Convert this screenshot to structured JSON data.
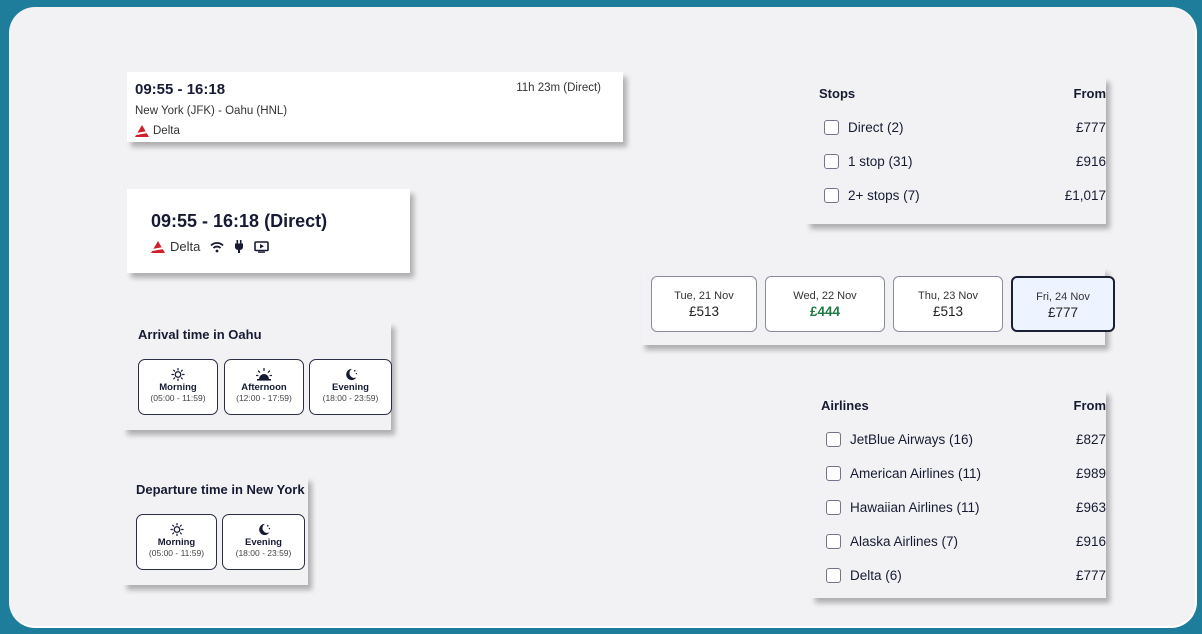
{
  "flight_summary": {
    "times": "09:55 - 16:18",
    "duration": "11h 23m (Direct)",
    "route": "New York (JFK) - Oahu (HNL)",
    "airline": "Delta",
    "airline_icon": "delta-logo-icon"
  },
  "flight_compact": {
    "times": "09:55 - 16:18 (Direct)",
    "airline": "Delta",
    "amenities": [
      "wifi-icon",
      "power-plug-icon",
      "entertainment-screen-icon"
    ]
  },
  "arrival_filter": {
    "title": "Arrival time in Oahu",
    "options": [
      {
        "label": "Morning",
        "range": "(05:00 - 11:59)",
        "icon": "sun-icon"
      },
      {
        "label": "Afternoon",
        "range": "(12:00 - 17:59)",
        "icon": "sunset-icon"
      },
      {
        "label": "Evening",
        "range": "(18:00 - 23:59)",
        "icon": "moon-icon"
      }
    ]
  },
  "departure_filter": {
    "title": "Departure time in New York",
    "options": [
      {
        "label": "Morning",
        "range": "(05:00 - 11:59)",
        "icon": "sun-icon"
      },
      {
        "label": "Evening",
        "range": "(18:00 - 23:59)",
        "icon": "moon-icon"
      }
    ]
  },
  "stops_filter": {
    "title": "Stops",
    "from_label": "From",
    "items": [
      {
        "label": "Direct (2)",
        "price": "£777",
        "checked": false
      },
      {
        "label": "1 stop (31)",
        "price": "£916",
        "checked": false
      },
      {
        "label": "2+ stops (7)",
        "price": "£1,017",
        "checked": false
      }
    ]
  },
  "date_options": [
    {
      "date": "Tue, 21 Nov",
      "price": "£513",
      "cheapest": false,
      "selected": false
    },
    {
      "date": "Wed, 22 Nov",
      "price": "£444",
      "cheapest": true,
      "selected": false
    },
    {
      "date": "Thu, 23 Nov",
      "price": "£513",
      "cheapest": false,
      "selected": false
    },
    {
      "date": "Fri, 24 Nov",
      "price": "£777",
      "cheapest": false,
      "selected": true
    }
  ],
  "colors": {
    "cheapest_price": "#1d7a43",
    "selected_date_bg": "#edf3ff",
    "delta_red": "#d0202e",
    "frame": "#1e7d9a"
  },
  "airlines_filter": {
    "title": "Airlines",
    "from_label": "From",
    "items": [
      {
        "label": "JetBlue Airways (16)",
        "price": "£827",
        "checked": false
      },
      {
        "label": "American Airlines (11)",
        "price": "£989",
        "checked": false
      },
      {
        "label": "Hawaiian Airlines (11)",
        "price": "£963",
        "checked": false
      },
      {
        "label": "Alaska Airlines (7)",
        "price": "£916",
        "checked": false
      },
      {
        "label": "Delta (6)",
        "price": "£777",
        "checked": false
      }
    ]
  }
}
